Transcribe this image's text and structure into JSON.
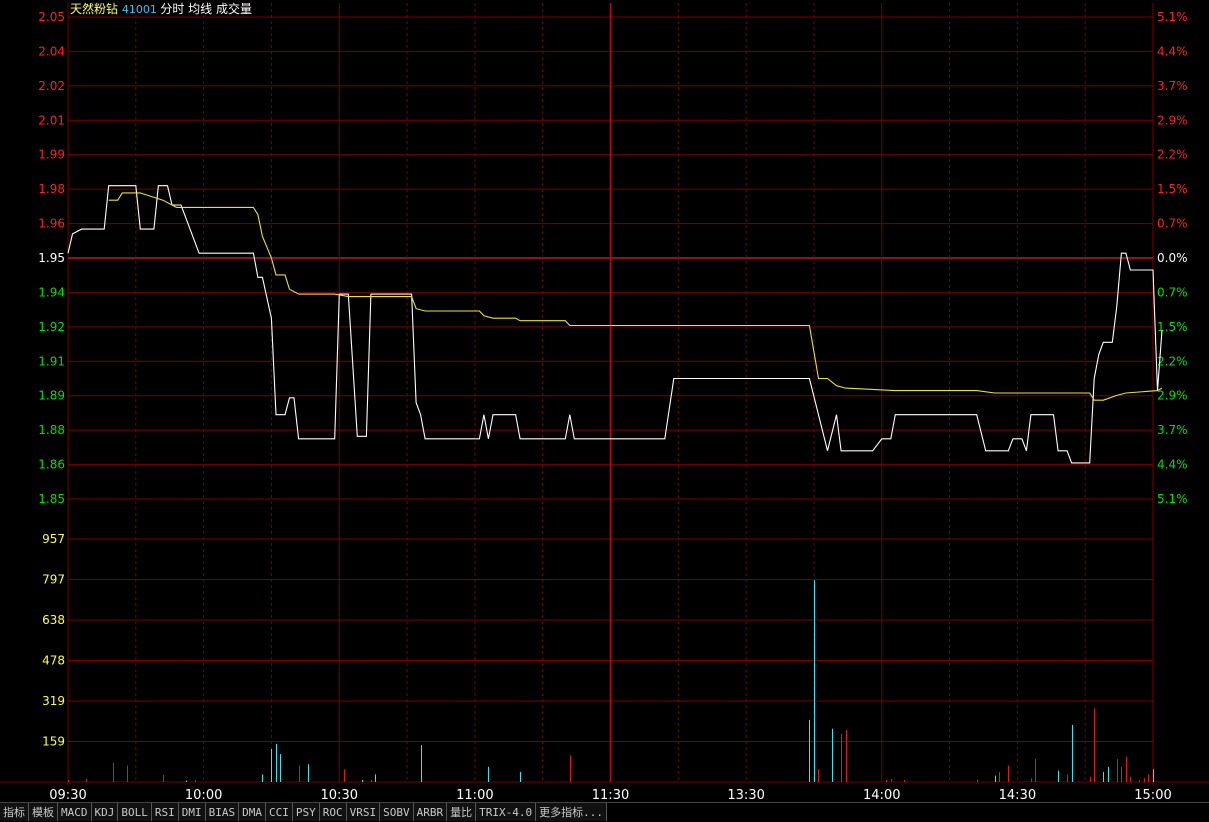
{
  "header": {
    "name": "天然粉钻",
    "code": "41001",
    "items": [
      "分时",
      "均线",
      "成交量"
    ]
  },
  "colors": {
    "up": "#ff2020",
    "down": "#00e000",
    "neutral": "#ffffff",
    "grid": "#7a0000",
    "volume_label": "#ffff40",
    "price_line": "#ffffff",
    "avg_line": "#e8e040",
    "vol_up": "#d02020",
    "vol_down": "#40e0f0"
  },
  "tabs": [
    "指标",
    "模板",
    "MACD",
    "KDJ",
    "BOLL",
    "RSI",
    "DMI",
    "BIAS",
    "DMA",
    "CCI",
    "PSY",
    "ROC",
    "VRSI",
    "SOBV",
    "ARBR",
    "量比",
    "TRIX-4.0",
    "更多指标..."
  ],
  "chart_data": {
    "type": "line",
    "prev_close": 1.95,
    "price_ticks": [
      "2.05",
      "2.04",
      "2.02",
      "2.01",
      "1.99",
      "1.98",
      "1.96",
      "1.95",
      "1.94",
      "1.92",
      "1.91",
      "1.89",
      "1.88",
      "1.86",
      "1.85"
    ],
    "pct_ticks": [
      "5.1%",
      "4.4%",
      "3.7%",
      "2.9%",
      "2.2%",
      "1.5%",
      "0.7%",
      "0.0%",
      "0.7%",
      "1.5%",
      "2.2%",
      "2.9%",
      "3.7%",
      "4.4%",
      "5.1%"
    ],
    "volume_ticks": [
      "957",
      "797",
      "638",
      "478",
      "319",
      "159"
    ],
    "ylim_price": [
      1.85,
      2.05
    ],
    "ylim_volume": [
      0,
      1117
    ],
    "x_ticks": [
      "09:30",
      "10:00",
      "10:30",
      "11:00",
      "11:30",
      "13:30",
      "14:00",
      "14:30",
      "15:00"
    ],
    "minutes_total": 240,
    "series": [
      {
        "points": [
          [
            0,
            1.952
          ],
          [
            1,
            1.96
          ],
          [
            3,
            1.962
          ],
          [
            5,
            1.962
          ],
          [
            8,
            1.962
          ],
          [
            9,
            1.98
          ],
          [
            11,
            1.98
          ],
          [
            15,
            1.98
          ],
          [
            16,
            1.962
          ],
          [
            19,
            1.962
          ],
          [
            20,
            1.98
          ],
          [
            22,
            1.98
          ],
          [
            23,
            1.972
          ],
          [
            25,
            1.972
          ],
          [
            29,
            1.952
          ],
          [
            33,
            1.952
          ],
          [
            41,
            1.952
          ],
          [
            42,
            1.942
          ],
          [
            43,
            1.942
          ],
          [
            45,
            1.925
          ],
          [
            46,
            1.885
          ],
          [
            48,
            1.885
          ],
          [
            49,
            1.892
          ],
          [
            50,
            1.892
          ],
          [
            51,
            1.875
          ],
          [
            59,
            1.875
          ],
          [
            60,
            1.935
          ],
          [
            62,
            1.935
          ],
          [
            64,
            1.876
          ],
          [
            66,
            1.876
          ],
          [
            67,
            1.935
          ],
          [
            76,
            1.935
          ],
          [
            77,
            1.89
          ],
          [
            78,
            1.885
          ],
          [
            79,
            1.875
          ],
          [
            91,
            1.875
          ],
          [
            92,
            1.885
          ],
          [
            93,
            1.875
          ],
          [
            94,
            1.885
          ],
          [
            99,
            1.885
          ],
          [
            100,
            1.875
          ],
          [
            110,
            1.875
          ],
          [
            111,
            1.885
          ],
          [
            112,
            1.875
          ],
          [
            132,
            1.875
          ],
          [
            134,
            1.9
          ],
          [
            143,
            1.9
          ],
          [
            150,
            1.9
          ],
          [
            164,
            1.9
          ],
          [
            166,
            1.885
          ],
          [
            168,
            1.87
          ],
          [
            170,
            1.885
          ],
          [
            171,
            1.87
          ],
          [
            178,
            1.87
          ],
          [
            180,
            1.875
          ],
          [
            182,
            1.875
          ],
          [
            183,
            1.885
          ],
          [
            201,
            1.885
          ],
          [
            203,
            1.87
          ],
          [
            208,
            1.87
          ],
          [
            209,
            1.875
          ],
          [
            211,
            1.875
          ],
          [
            212,
            1.87
          ],
          [
            213,
            1.885
          ],
          [
            218,
            1.885
          ],
          [
            219,
            1.87
          ],
          [
            221,
            1.87
          ],
          [
            222,
            1.865
          ],
          [
            226,
            1.865
          ],
          [
            227,
            1.9
          ],
          [
            228,
            1.91
          ],
          [
            229,
            1.915
          ],
          [
            231,
            1.915
          ],
          [
            232,
            1.93
          ],
          [
            233,
            1.952
          ],
          [
            234,
            1.952
          ],
          [
            235,
            1.945
          ],
          [
            240,
            1.945
          ],
          [
            241,
            1.895
          ],
          [
            242,
            1.92
          ]
        ]
      },
      {
        "points": [
          [
            9,
            1.974
          ],
          [
            11,
            1.974
          ],
          [
            12,
            1.977
          ],
          [
            16,
            1.977
          ],
          [
            21,
            1.974
          ],
          [
            24,
            1.971
          ],
          [
            28,
            1.971
          ],
          [
            41,
            1.971
          ],
          [
            42,
            1.968
          ],
          [
            43,
            1.959
          ],
          [
            45,
            1.95
          ],
          [
            46,
            1.943
          ],
          [
            48,
            1.943
          ],
          [
            49,
            1.937
          ],
          [
            51,
            1.935
          ],
          [
            59,
            1.935
          ],
          [
            62,
            1.934
          ],
          [
            76,
            1.934
          ],
          [
            77,
            1.929
          ],
          [
            79,
            1.928
          ],
          [
            91,
            1.928
          ],
          [
            92,
            1.926
          ],
          [
            94,
            1.925
          ],
          [
            99,
            1.925
          ],
          [
            100,
            1.924
          ],
          [
            110,
            1.924
          ],
          [
            111,
            1.922
          ],
          [
            164,
            1.922
          ],
          [
            166,
            1.9
          ],
          [
            168,
            1.9
          ],
          [
            170,
            1.897
          ],
          [
            172,
            1.896
          ],
          [
            183,
            1.895
          ],
          [
            201,
            1.895
          ],
          [
            205,
            1.894
          ],
          [
            226,
            1.894
          ],
          [
            227,
            1.891
          ],
          [
            229,
            1.891
          ],
          [
            232,
            1.893
          ],
          [
            234,
            1.894
          ],
          [
            241,
            1.895
          ],
          [
            242,
            1.896
          ]
        ]
      }
    ],
    "volume": [
      [
        0,
        8,
        "up"
      ],
      [
        4,
        12,
        "up"
      ],
      [
        10,
        75,
        "up"
      ],
      [
        13,
        65,
        "up"
      ],
      [
        21,
        28,
        "up"
      ],
      [
        26,
        6,
        "down"
      ],
      [
        28,
        8,
        "up"
      ],
      [
        43,
        30,
        "down"
      ],
      [
        45,
        130,
        "down"
      ],
      [
        46,
        150,
        "down"
      ],
      [
        47,
        110,
        "down"
      ],
      [
        51,
        65,
        "up"
      ],
      [
        53,
        70,
        "down"
      ],
      [
        61,
        50,
        "up"
      ],
      [
        65,
        8,
        "down"
      ],
      [
        67,
        8,
        "up"
      ],
      [
        68,
        30,
        "down"
      ],
      [
        78,
        145,
        "down"
      ],
      [
        93,
        60,
        "down"
      ],
      [
        100,
        40,
        "down"
      ],
      [
        111,
        105,
        "up"
      ],
      [
        164,
        245,
        "down"
      ],
      [
        165,
        795,
        "down"
      ],
      [
        166,
        50,
        "up"
      ],
      [
        169,
        210,
        "down"
      ],
      [
        171,
        190,
        "up"
      ],
      [
        172,
        205,
        "up"
      ],
      [
        181,
        8,
        "up"
      ],
      [
        182,
        12,
        "up"
      ],
      [
        185,
        8,
        "up"
      ],
      [
        201,
        10,
        "up"
      ],
      [
        205,
        25,
        "down"
      ],
      [
        206,
        40,
        "up"
      ],
      [
        208,
        65,
        "up"
      ],
      [
        213,
        15,
        "up"
      ],
      [
        214,
        90,
        "up"
      ],
      [
        219,
        45,
        "down"
      ],
      [
        221,
        30,
        "up"
      ],
      [
        222,
        225,
        "down"
      ],
      [
        226,
        20,
        "up"
      ],
      [
        227,
        290,
        "up"
      ],
      [
        229,
        40,
        "down"
      ],
      [
        230,
        60,
        "down"
      ],
      [
        232,
        90,
        "up"
      ],
      [
        233,
        60,
        "up"
      ],
      [
        234,
        100,
        "up"
      ],
      [
        235,
        20,
        "up"
      ],
      [
        237,
        8,
        "up"
      ],
      [
        238,
        15,
        "up"
      ],
      [
        239,
        30,
        "up"
      ],
      [
        240,
        50,
        "down"
      ]
    ]
  }
}
